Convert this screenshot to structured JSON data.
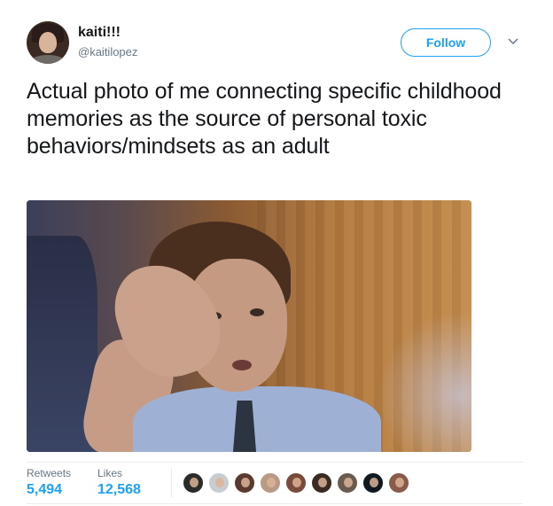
{
  "author": {
    "display_name": "kaiti!!!",
    "handle": "@kaitilopez"
  },
  "follow_button": {
    "label": "Follow"
  },
  "tweet": {
    "text": "Actual photo of me connecting specific childhood memories as the source of personal toxic behaviors/mindsets as an adult"
  },
  "stats": {
    "retweets_label": "Retweets",
    "retweets_value": "5,494",
    "likes_label": "Likes",
    "likes_value": "12,568"
  },
  "likers": [
    {
      "color": "#2b2b2b"
    },
    {
      "color": "#c8cdd2"
    },
    {
      "color": "#5a3a2e"
    },
    {
      "color": "#b89a86"
    },
    {
      "color": "#7a4a3a"
    },
    {
      "color": "#3a2a24"
    },
    {
      "color": "#6a5a50"
    },
    {
      "color": "#101820"
    },
    {
      "color": "#8a5a4a"
    }
  ],
  "colors": {
    "accent": "#1da1f2",
    "secondary_text": "#657786",
    "primary_text": "#14171a"
  }
}
